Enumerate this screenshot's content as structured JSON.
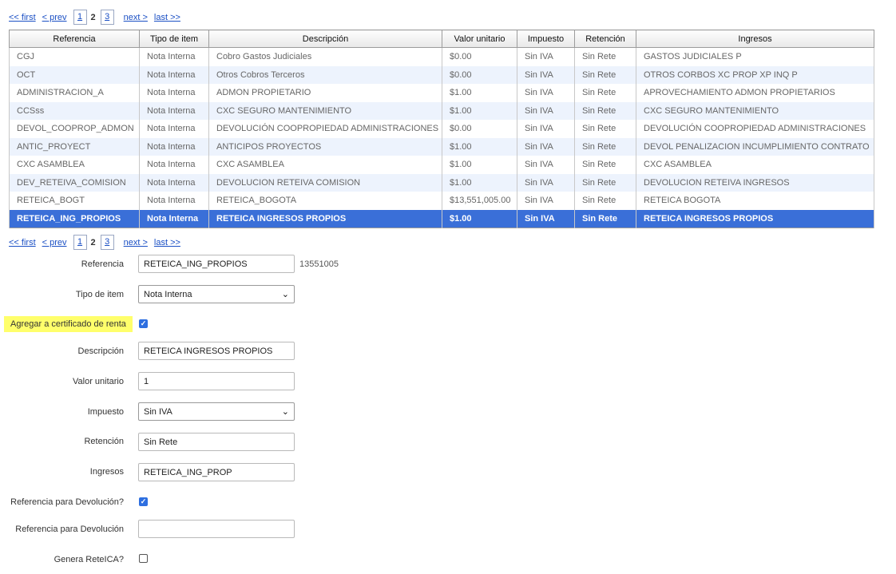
{
  "pager": {
    "first": "<< first",
    "prev": "< prev",
    "pages": [
      "1",
      "2",
      "3"
    ],
    "next": "next >",
    "last": "last >>"
  },
  "table": {
    "columns": [
      "Referencia",
      "Tipo de item",
      "Descripción",
      "Valor unitario",
      "Impuesto",
      "Retención",
      "Ingresos"
    ],
    "rows": [
      [
        "CGJ",
        "Nota Interna",
        "Cobro Gastos Judiciales",
        "$0.00",
        "Sin IVA",
        "Sin Rete",
        "GASTOS JUDICIALES P"
      ],
      [
        "OCT",
        "Nota Interna",
        "Otros Cobros Terceros",
        "$0.00",
        "Sin IVA",
        "Sin Rete",
        "OTROS CORBOS XC PROP XP INQ P"
      ],
      [
        "ADMINISTRACION_A",
        "Nota Interna",
        "ADMON PROPIETARIO",
        "$1.00",
        "Sin IVA",
        "Sin Rete",
        "APROVECHAMIENTO ADMON PROPIETARIOS"
      ],
      [
        "CCSss",
        "Nota Interna",
        "CXC SEGURO MANTENIMIENTO",
        "$1.00",
        "Sin IVA",
        "Sin Rete",
        "CXC SEGURO MANTENIMIENTO"
      ],
      [
        "DEVOL_COOPROP_ADMON",
        "Nota Interna",
        "DEVOLUCIÓN COOPROPIEDAD ADMINISTRACIONES",
        "$0.00",
        "Sin IVA",
        "Sin Rete",
        "DEVOLUCIÓN COOPROPIEDAD ADMINISTRACIONES"
      ],
      [
        "ANTIC_PROYECT",
        "Nota Interna",
        "ANTICIPOS PROYECTOS",
        "$1.00",
        "Sin IVA",
        "Sin Rete",
        "DEVOL PENALIZACION INCUMPLIMIENTO CONTRATO"
      ],
      [
        "CXC ASAMBLEA",
        "Nota Interna",
        "CXC ASAMBLEA",
        "$1.00",
        "Sin IVA",
        "Sin Rete",
        "CXC ASAMBLEA"
      ],
      [
        "DEV_RETEIVA_COMISION",
        "Nota Interna",
        "DEVOLUCION RETEIVA COMISION",
        "$1.00",
        "Sin IVA",
        "Sin Rete",
        "DEVOLUCION RETEIVA INGRESOS"
      ],
      [
        "RETEICA_BOGT",
        "Nota Interna",
        "RETEICA_BOGOTA",
        "$13,551,005.00",
        "Sin IVA",
        "Sin Rete",
        "RETEICA BOGOTA"
      ],
      [
        "RETEICA_ING_PROPIOS",
        "Nota Interna",
        "RETEICA INGRESOS PROPIOS",
        "$1.00",
        "Sin IVA",
        "Sin Rete",
        "RETEICA INGRESOS PROPIOS"
      ]
    ]
  },
  "form": {
    "referencia_label": "Referencia",
    "referencia_value": "RETEICA_ING_PROPIOS",
    "referencia_side": "13551005",
    "tipo_label": "Tipo de item",
    "tipo_value": "Nota Interna",
    "certificado_label": "Agregar a certificado de renta",
    "certificado_checked": "true",
    "descripcion_label": "Descripción",
    "descripcion_value": "RETEICA INGRESOS PROPIOS",
    "valor_label": "Valor unitario",
    "valor_value": "1",
    "impuesto_label": "Impuesto",
    "impuesto_value": "Sin IVA",
    "retencion_label": "Retención",
    "retencion_value": "Sin Rete",
    "ingresos_label": "Ingresos",
    "ingresos_value": "RETEICA_ING_PROP",
    "ref_devolucion_q_label": "Referencia para Devolución?",
    "ref_devolucion_q_checked": "true",
    "ref_devolucion_label": "Referencia para Devolución",
    "ref_devolucion_value": "",
    "genera_reteica_label": "Genera ReteICA?",
    "genera_reteica_checked": "false"
  },
  "colors": {
    "accent": "#3a6fd8",
    "highlight": "#ffff6b",
    "checkbox": "#2e6fe0"
  }
}
